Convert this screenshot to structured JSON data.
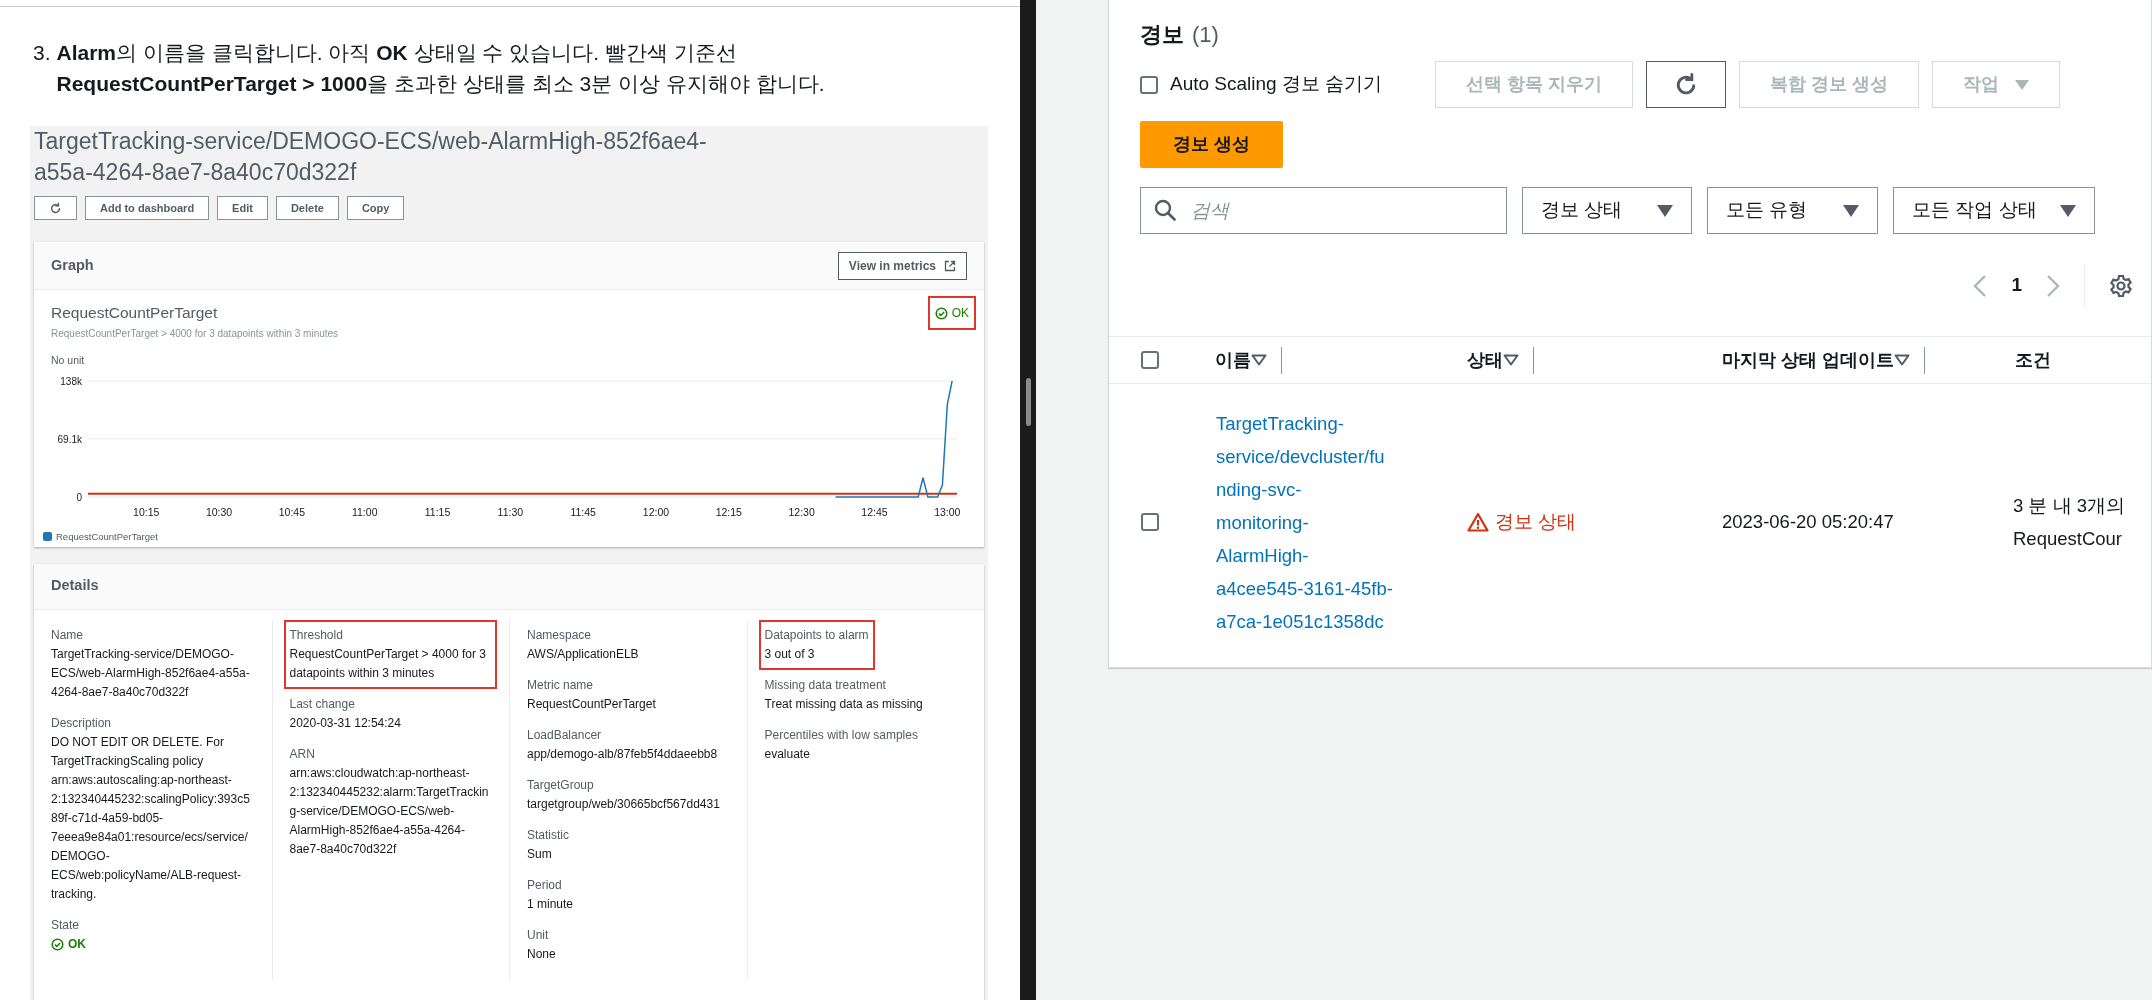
{
  "instruction": {
    "number": "3.",
    "lines": [
      "**Alarm**의 이름을 클릭합니다. 아직 **OK** 상태일 수 있습니다. 빨간색 기준선",
      "**RequestCountPerTarget > 1000**을 초과한 상태를 최소 3분 이상 유지해야 합니다."
    ]
  },
  "alarm_screenshot": {
    "title_lines": [
      "TargetTracking-service/DEMOGO-ECS/web-AlarmHigh-852f6ae4-",
      "a55a-4264-8ae7-8a40c70d322f"
    ],
    "toolbar": [
      {
        "kind": "refresh"
      },
      {
        "kind": "text",
        "label": "Add to dashboard"
      },
      {
        "kind": "text",
        "label": "Edit"
      },
      {
        "kind": "text",
        "label": "Delete"
      },
      {
        "kind": "text",
        "label": "Copy"
      }
    ],
    "graph": {
      "title": "Graph",
      "action": "View in metrics",
      "metric_title": "RequestCountPerTarget",
      "state": "OK",
      "state_highlighted": true,
      "subtitle": "RequestCountPerTarget > 4000 for 3 datapoints within 3 minutes",
      "unit": "No unit",
      "chart_data": {
        "type": "line",
        "x": [
          757,
          774,
          775,
          776,
          778,
          779,
          780,
          781
        ],
        "xlim": [
          603,
          782
        ],
        "ylim": [
          0,
          138000
        ],
        "xticks": [
          {
            "value": 615,
            "label": "10:15"
          },
          {
            "value": 630,
            "label": "10:30"
          },
          {
            "value": 645,
            "label": "10:45"
          },
          {
            "value": 660,
            "label": "11:00"
          },
          {
            "value": 675,
            "label": "11:15"
          },
          {
            "value": 690,
            "label": "11:30"
          },
          {
            "value": 705,
            "label": "11:45"
          },
          {
            "value": 720,
            "label": "12:00"
          },
          {
            "value": 735,
            "label": "12:15"
          },
          {
            "value": 750,
            "label": "12:30"
          },
          {
            "value": 765,
            "label": "12:45"
          },
          {
            "value": 780,
            "label": "13:00"
          }
        ],
        "yticks": [
          {
            "value": 0,
            "label": "0"
          },
          {
            "value": 69100,
            "label": "69.1k"
          },
          {
            "value": 138000,
            "label": "138k"
          }
        ],
        "series": [
          {
            "name": "RequestCountPerTarget",
            "color": "#1f77b4",
            "values": [
              0,
              0,
              23000,
              0,
              0,
              14000,
              110000,
              138000
            ]
          }
        ],
        "ref_lines": [
          {
            "axis": "y",
            "value": 4000,
            "color": "#d13212"
          }
        ]
      }
    },
    "details": {
      "title": "Details",
      "columns": [
        [
          {
            "label": "Name",
            "value": "TargetTracking-service/DEMOGO-ECS/web-AlarmHigh-852f6ae4-a55a-4264-8ae7-8a40c70d322f",
            "highlighted": false,
            "kind": "text"
          },
          {
            "label": "Description",
            "value": "DO NOT EDIT OR DELETE. For TargetTrackingScaling policy arn:aws:autoscaling:ap-northeast-2:132340445232:scalingPolicy:393c589f-c71d-4a59-bd05-7eeea9e84a01:resource/ecs/service/DEMOGO-ECS/web:policyName/ALB-request-tracking.",
            "highlighted": false,
            "kind": "text"
          },
          {
            "label": "State",
            "value": "OK",
            "highlighted": false,
            "kind": "status"
          }
        ],
        [
          {
            "label": "Threshold",
            "value": "RequestCountPerTarget > 4000 for 3 datapoints within 3 minutes",
            "highlighted": true,
            "kind": "text"
          },
          {
            "label": "Last change",
            "value": "2020-03-31 12:54:24",
            "highlighted": false,
            "kind": "text"
          },
          {
            "label": "ARN",
            "value": "arn:aws:cloudwatch:ap-northeast-2:132340445232:alarm:TargetTracking-service/DEMOGO-ECS/web-AlarmHigh-852f6ae4-a55a-4264-8ae7-8a40c70d322f",
            "highlighted": false,
            "kind": "text"
          }
        ],
        [
          {
            "label": "Namespace",
            "value": "AWS/ApplicationELB",
            "highlighted": false,
            "kind": "text"
          },
          {
            "label": "Metric name",
            "value": "RequestCountPerTarget",
            "highlighted": false,
            "kind": "text"
          },
          {
            "label": "LoadBalancer",
            "value": "app/demogo-alb/87feb5f4ddaeebb8",
            "highlighted": false,
            "kind": "text"
          },
          {
            "label": "TargetGroup",
            "value": "targetgroup/web/30665bcf567dd431",
            "highlighted": false,
            "kind": "text"
          },
          {
            "label": "Statistic",
            "value": "Sum",
            "highlighted": false,
            "kind": "text"
          },
          {
            "label": "Period",
            "value": "1 minute",
            "highlighted": false,
            "kind": "text"
          },
          {
            "label": "Unit",
            "value": "None",
            "highlighted": false,
            "kind": "text"
          }
        ],
        [
          {
            "label": "Datapoints to alarm",
            "value": "3 out of 3",
            "highlighted": true,
            "kind": "text"
          },
          {
            "label": "Missing data treatment",
            "value": "Treat missing data as missing",
            "highlighted": false,
            "kind": "text"
          },
          {
            "label": "Percentiles with low samples",
            "value": "evaluate",
            "highlighted": false,
            "kind": "text"
          }
        ]
      ]
    }
  },
  "alarms_panel": {
    "title": "경보",
    "count": "(1)",
    "hide_autoscaling": {
      "label": "Auto Scaling 경보 숨기기",
      "checked": false
    },
    "actions": [
      {
        "kind": "text",
        "label": "선택 항목 지우기",
        "disabled": true
      },
      {
        "kind": "refresh",
        "disabled": false
      },
      {
        "kind": "text",
        "label": "복합 경보 생성",
        "disabled": true
      },
      {
        "kind": "dropdown",
        "label": "작업",
        "disabled": true
      }
    ],
    "create_button": "경보 생성",
    "search": {
      "placeholder": "검색"
    },
    "filters": [
      "경보 상태",
      "모든 유형",
      "모든 작업 상태"
    ],
    "pagination": {
      "page": "1",
      "prev_disabled": true,
      "next_disabled": true
    },
    "table": {
      "select_all_checked": false,
      "columns": [
        {
          "label": "이름",
          "sortable": true
        },
        {
          "label": "상태",
          "sortable": true
        },
        {
          "label": "마지막 상태 업데이트",
          "sortable": true
        },
        {
          "label": "조건",
          "sortable": false
        }
      ],
      "rows": [
        {
          "checked": false,
          "name": "TargetTracking-service/devcluster/funding-svc-monitoring-AlarmHigh-a4cee545-3161-45fb-a7ca-1e051c1358dc",
          "state": "경보 상태",
          "last_update": "2023-06-20 05:20:47",
          "condition": "3 분 내 3개의 RequestCour"
        }
      ]
    }
  }
}
